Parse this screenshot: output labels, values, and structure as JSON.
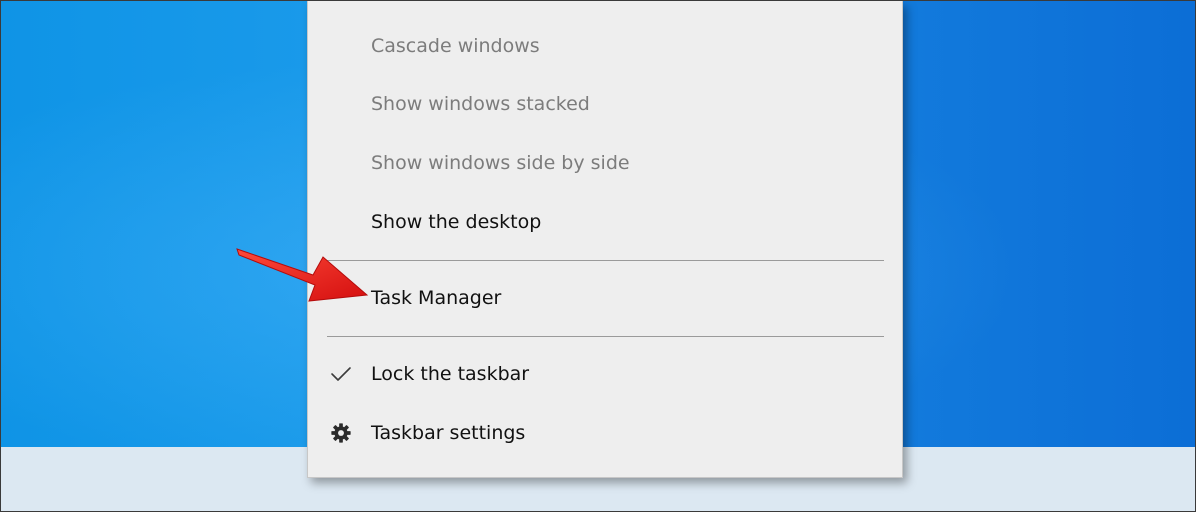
{
  "context_menu": {
    "items": [
      {
        "label": "Cascade windows",
        "enabled": false
      },
      {
        "label": "Show windows stacked",
        "enabled": false
      },
      {
        "label": "Show windows side by side",
        "enabled": false
      },
      {
        "label": "Show the desktop",
        "enabled": true
      },
      {
        "label": "Task Manager",
        "enabled": true,
        "highlighted_by_arrow": true
      },
      {
        "label": "Lock the taskbar",
        "enabled": true,
        "checked": true,
        "icon": "checkmark-icon"
      },
      {
        "label": "Taskbar settings",
        "enabled": true,
        "icon": "gear-icon"
      }
    ]
  },
  "colors": {
    "wallpaper": "#1a9aea",
    "menu_background": "#eeeeee",
    "disabled_text": "#7c7c7c",
    "annotation_arrow": "#e21a1a"
  }
}
